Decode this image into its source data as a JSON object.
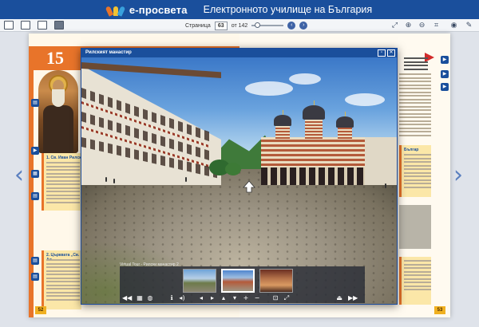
{
  "header": {
    "brand": "е-просвета",
    "tagline": "Електронното училище на България",
    "brand_colors": [
      "#e8742a",
      "#f2c232",
      "#39a0dc"
    ]
  },
  "toolbar": {
    "page_label": "Страница",
    "page_value": "63",
    "of_label": "от 142",
    "prev_icon": "chevron-left-icon",
    "next_icon": "chevron-right-icon"
  },
  "book": {
    "lesson_number": "15",
    "left_page_number": "52",
    "right_page_number": "53",
    "heading_1": "1. Св. Иван Рилск",
    "heading_2": "2. Църквата „Св. Ал",
    "right_heading": "Българ"
  },
  "modal": {
    "title": "Рилският манастир",
    "minimize_icon": "minimize-icon",
    "close_icon": "close-icon",
    "tour_label": "Virtual Tour - Рилски манастир 2"
  },
  "colors": {
    "header_bg": "#1a4f9c",
    "accent_orange": "#e8742a",
    "modal_border": "#1b4a9a"
  }
}
